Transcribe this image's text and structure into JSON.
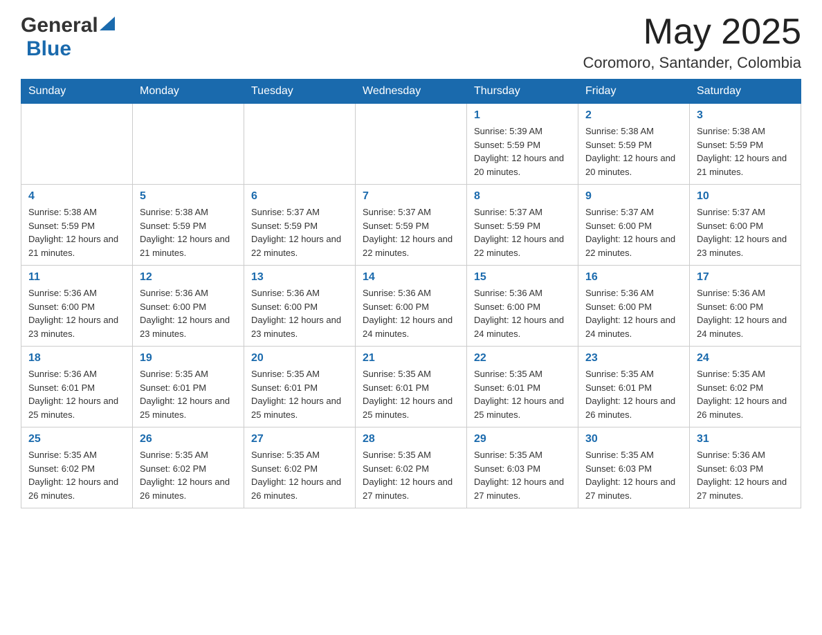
{
  "header": {
    "logo_general": "General",
    "logo_blue": "Blue",
    "month_title": "May 2025",
    "location": "Coromoro, Santander, Colombia"
  },
  "weekdays": [
    "Sunday",
    "Monday",
    "Tuesday",
    "Wednesday",
    "Thursday",
    "Friday",
    "Saturday"
  ],
  "weeks": [
    [
      {
        "day": "",
        "info": ""
      },
      {
        "day": "",
        "info": ""
      },
      {
        "day": "",
        "info": ""
      },
      {
        "day": "",
        "info": ""
      },
      {
        "day": "1",
        "info": "Sunrise: 5:39 AM\nSunset: 5:59 PM\nDaylight: 12 hours and 20 minutes."
      },
      {
        "day": "2",
        "info": "Sunrise: 5:38 AM\nSunset: 5:59 PM\nDaylight: 12 hours and 20 minutes."
      },
      {
        "day": "3",
        "info": "Sunrise: 5:38 AM\nSunset: 5:59 PM\nDaylight: 12 hours and 21 minutes."
      }
    ],
    [
      {
        "day": "4",
        "info": "Sunrise: 5:38 AM\nSunset: 5:59 PM\nDaylight: 12 hours and 21 minutes."
      },
      {
        "day": "5",
        "info": "Sunrise: 5:38 AM\nSunset: 5:59 PM\nDaylight: 12 hours and 21 minutes."
      },
      {
        "day": "6",
        "info": "Sunrise: 5:37 AM\nSunset: 5:59 PM\nDaylight: 12 hours and 22 minutes."
      },
      {
        "day": "7",
        "info": "Sunrise: 5:37 AM\nSunset: 5:59 PM\nDaylight: 12 hours and 22 minutes."
      },
      {
        "day": "8",
        "info": "Sunrise: 5:37 AM\nSunset: 5:59 PM\nDaylight: 12 hours and 22 minutes."
      },
      {
        "day": "9",
        "info": "Sunrise: 5:37 AM\nSunset: 6:00 PM\nDaylight: 12 hours and 22 minutes."
      },
      {
        "day": "10",
        "info": "Sunrise: 5:37 AM\nSunset: 6:00 PM\nDaylight: 12 hours and 23 minutes."
      }
    ],
    [
      {
        "day": "11",
        "info": "Sunrise: 5:36 AM\nSunset: 6:00 PM\nDaylight: 12 hours and 23 minutes."
      },
      {
        "day": "12",
        "info": "Sunrise: 5:36 AM\nSunset: 6:00 PM\nDaylight: 12 hours and 23 minutes."
      },
      {
        "day": "13",
        "info": "Sunrise: 5:36 AM\nSunset: 6:00 PM\nDaylight: 12 hours and 23 minutes."
      },
      {
        "day": "14",
        "info": "Sunrise: 5:36 AM\nSunset: 6:00 PM\nDaylight: 12 hours and 24 minutes."
      },
      {
        "day": "15",
        "info": "Sunrise: 5:36 AM\nSunset: 6:00 PM\nDaylight: 12 hours and 24 minutes."
      },
      {
        "day": "16",
        "info": "Sunrise: 5:36 AM\nSunset: 6:00 PM\nDaylight: 12 hours and 24 minutes."
      },
      {
        "day": "17",
        "info": "Sunrise: 5:36 AM\nSunset: 6:00 PM\nDaylight: 12 hours and 24 minutes."
      }
    ],
    [
      {
        "day": "18",
        "info": "Sunrise: 5:36 AM\nSunset: 6:01 PM\nDaylight: 12 hours and 25 minutes."
      },
      {
        "day": "19",
        "info": "Sunrise: 5:35 AM\nSunset: 6:01 PM\nDaylight: 12 hours and 25 minutes."
      },
      {
        "day": "20",
        "info": "Sunrise: 5:35 AM\nSunset: 6:01 PM\nDaylight: 12 hours and 25 minutes."
      },
      {
        "day": "21",
        "info": "Sunrise: 5:35 AM\nSunset: 6:01 PM\nDaylight: 12 hours and 25 minutes."
      },
      {
        "day": "22",
        "info": "Sunrise: 5:35 AM\nSunset: 6:01 PM\nDaylight: 12 hours and 25 minutes."
      },
      {
        "day": "23",
        "info": "Sunrise: 5:35 AM\nSunset: 6:01 PM\nDaylight: 12 hours and 26 minutes."
      },
      {
        "day": "24",
        "info": "Sunrise: 5:35 AM\nSunset: 6:02 PM\nDaylight: 12 hours and 26 minutes."
      }
    ],
    [
      {
        "day": "25",
        "info": "Sunrise: 5:35 AM\nSunset: 6:02 PM\nDaylight: 12 hours and 26 minutes."
      },
      {
        "day": "26",
        "info": "Sunrise: 5:35 AM\nSunset: 6:02 PM\nDaylight: 12 hours and 26 minutes."
      },
      {
        "day": "27",
        "info": "Sunrise: 5:35 AM\nSunset: 6:02 PM\nDaylight: 12 hours and 26 minutes."
      },
      {
        "day": "28",
        "info": "Sunrise: 5:35 AM\nSunset: 6:02 PM\nDaylight: 12 hours and 27 minutes."
      },
      {
        "day": "29",
        "info": "Sunrise: 5:35 AM\nSunset: 6:03 PM\nDaylight: 12 hours and 27 minutes."
      },
      {
        "day": "30",
        "info": "Sunrise: 5:35 AM\nSunset: 6:03 PM\nDaylight: 12 hours and 27 minutes."
      },
      {
        "day": "31",
        "info": "Sunrise: 5:36 AM\nSunset: 6:03 PM\nDaylight: 12 hours and 27 minutes."
      }
    ]
  ]
}
